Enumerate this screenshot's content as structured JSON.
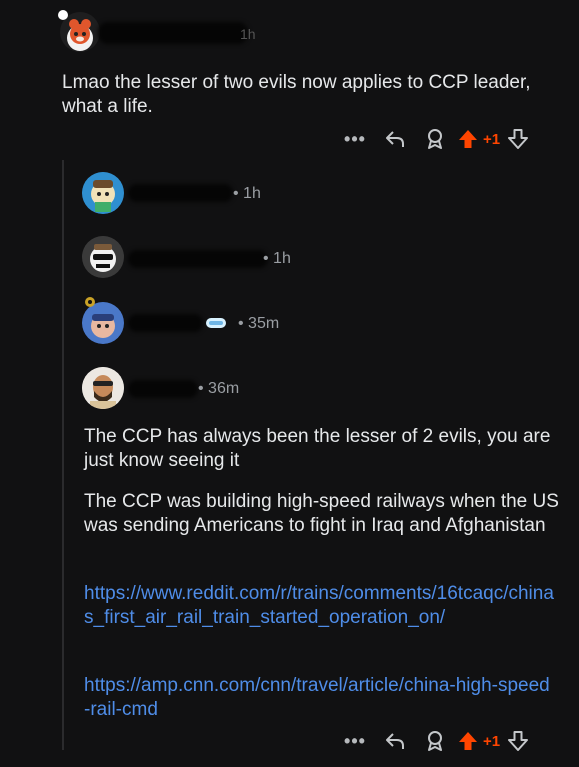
{
  "top_comment": {
    "time": "1h",
    "text": "Lmao the lesser of two evils now applies to CCP leader, what a life.",
    "votes": "+1",
    "more_label": "•••"
  },
  "collapsed_replies": [
    {
      "time": "• 1h"
    },
    {
      "time": "• 1h"
    },
    {
      "time": "• 35m"
    }
  ],
  "reply": {
    "time": "• 36m",
    "paragraph1": "The CCP has always been the lesser of 2 evils, you are just know seeing it",
    "paragraph2": "The CCP was building high-speed railways when the US was sending Americans to fight in Iraq and Afghanistan",
    "link1": "https://www.reddit.com/r/trains/comments/16tcaqc/chinas_first_air_rail_train_started_operation_on/",
    "link2": "https://amp.cnn.com/cnn/travel/article/china-high-speed-rail-cmd",
    "votes": "+1",
    "more_label": "•••"
  },
  "colors": {
    "background": "#111112",
    "upvote": "#ff4500",
    "link": "#4f8de8"
  },
  "icons": [
    "more-icon",
    "reply-icon",
    "award-icon",
    "upvote-icon",
    "downvote-icon"
  ]
}
